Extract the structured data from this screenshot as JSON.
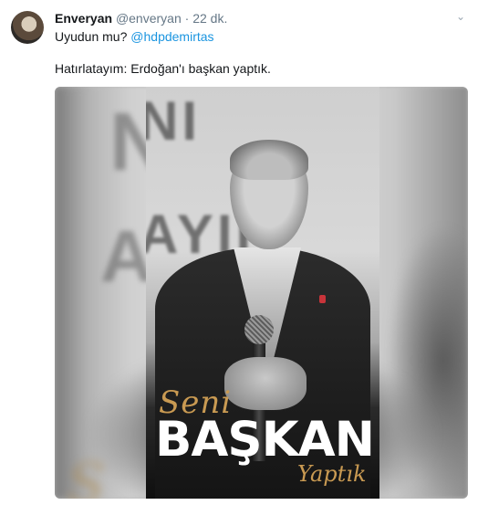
{
  "tweet": {
    "display_name": "Enveryan",
    "handle": "@enveryan",
    "separator": "·",
    "time": "22 dk.",
    "menu_icon": "chevron-down-icon",
    "reply_text": "Uyudun mu? ",
    "reply_mention": "@hdpdemirtas",
    "body_text": "Hatırlatayım: Erdoğan'ı başkan yaptık."
  },
  "media": {
    "poster_word_top": "Seni",
    "poster_word_main": "BAŞKAN",
    "poster_word_bottom": "Yaptık",
    "background_letters_top": "NI",
    "background_letters_bottom": "AYIR",
    "accent_gold": "#c99a52",
    "link_color": "#1b95e0"
  }
}
